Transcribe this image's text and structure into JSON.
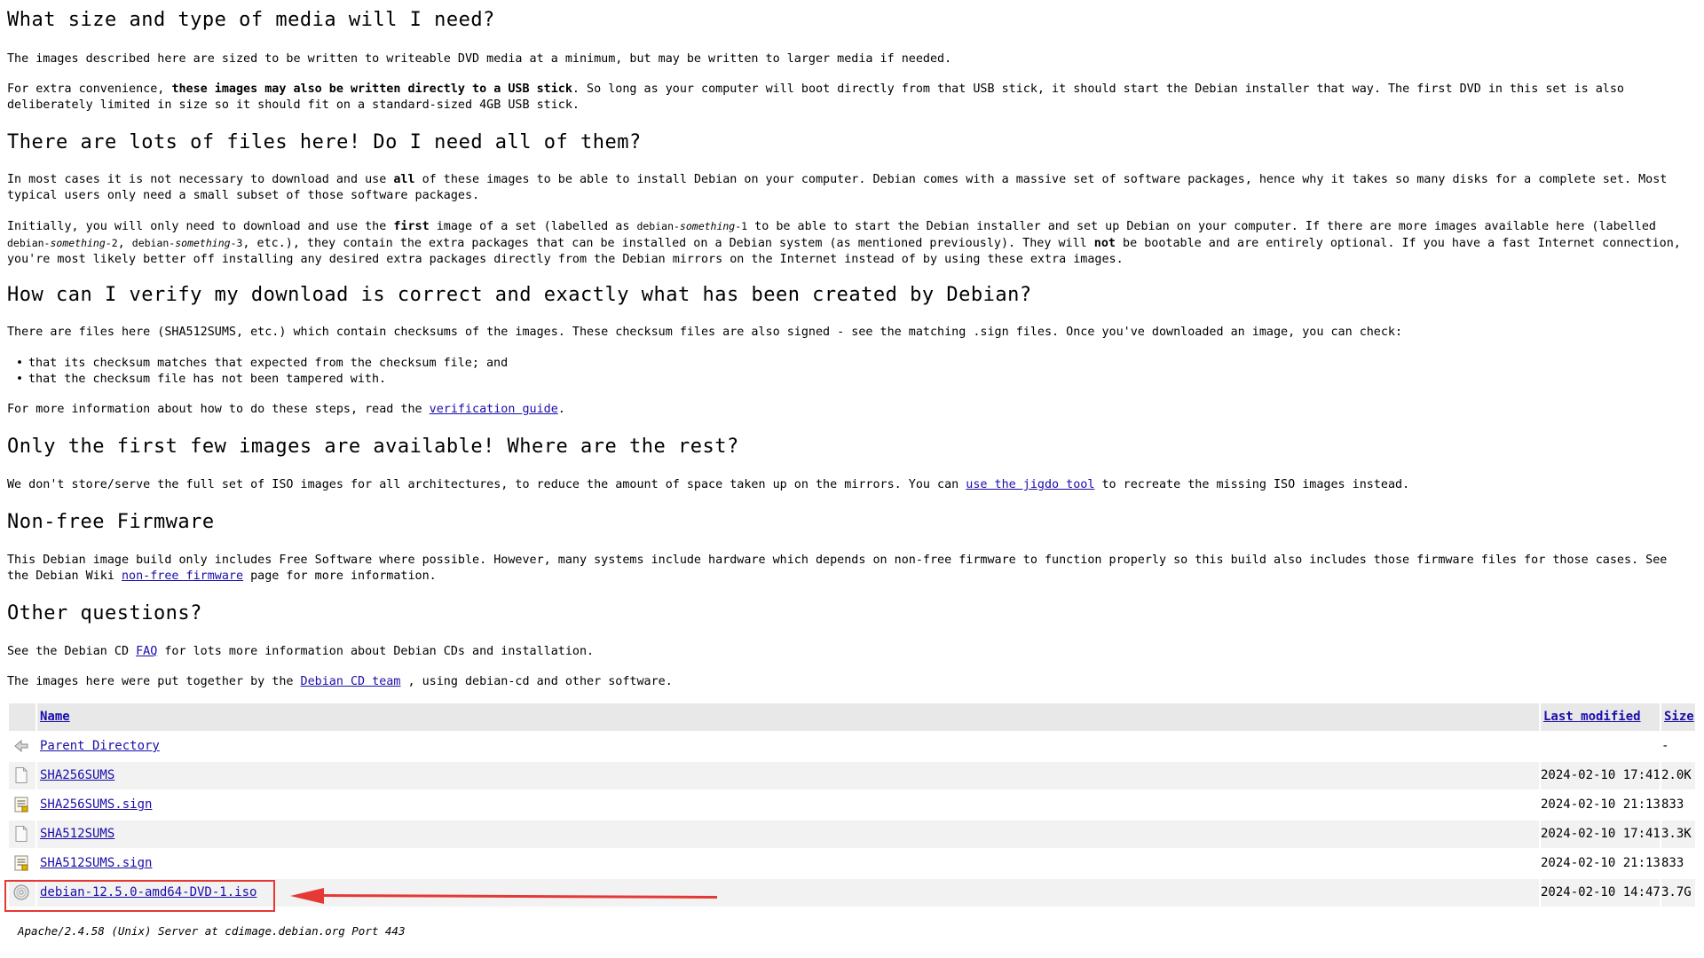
{
  "sections": {
    "media": {
      "heading": "What size and type of media will I need?",
      "p1": "The images described here are sized to be written to writeable DVD media at a minimum, but may be written to larger media if needed.",
      "p2_pre": "For extra convenience, ",
      "p2_bold": "these images may also be written directly to a USB stick",
      "p2_post": ". So long as your computer will boot directly from that USB stick, it should start the Debian installer that way. The first DVD in this set is also deliberately limited in size so it should fit on a standard-sized 4GB USB stick."
    },
    "files": {
      "heading": "There are lots of files here! Do I need all of them?",
      "p1_pre": "In most cases it is not necessary to download and use ",
      "p1_bold": "all",
      "p1_post": " of these images to be able to install Debian on your computer. Debian comes with a massive set of software packages, hence why it takes so many disks for a complete set. Most typical users only need a small subset of those software packages.",
      "p2_a": "Initially, you will only need to download and use the ",
      "p2_bold1": "first",
      "p2_b": " image of a set (labelled as ",
      "p2_ex1_pre": "debian-",
      "p2_ex1_it": "something",
      "p2_ex1_post": "-1",
      "p2_c": " to be able to start the Debian installer and set up Debian on your computer. If there are more images available here (labelled ",
      "p2_ex2_pre": "debian-",
      "p2_ex2_it": "something",
      "p2_ex2_post": "-2",
      "p2_sep": ", ",
      "p2_ex3_pre": "debian-",
      "p2_ex3_it": "something",
      "p2_ex3_post": "-3",
      "p2_d": ", etc.), they contain the extra packages that can be installed on a Debian system (as mentioned previously). They will ",
      "p2_bold2": "not",
      "p2_e": " be bootable and are entirely optional. If you have a fast Internet connection, you're most likely better off installing any desired extra packages directly from the Debian mirrors on the Internet instead of by using these extra images."
    },
    "verify": {
      "heading": "How can I verify my download is correct and exactly what has been created by Debian?",
      "p1": "There are files here (SHA512SUMS, etc.) which contain checksums of the images. These checksum files are also signed - see the matching .sign files. Once you've downloaded an image, you can check:",
      "bullets": [
        "that its checksum matches that expected from the checksum file; and",
        "that the checksum file has not been tampered with."
      ],
      "p2_pre": "For more information about how to do these steps, read the ",
      "p2_link": "verification guide",
      "p2_post": "."
    },
    "rest": {
      "heading": "Only the first few images are available! Where are the rest?",
      "p1_pre": "We don't store/serve the full set of ISO images for all architectures, to reduce the amount of space taken up on the mirrors. You can ",
      "p1_link": "use the jigdo tool",
      "p1_post": " to recreate the missing ISO images instead."
    },
    "firmware": {
      "heading": "Non-free Firmware",
      "p1_pre": "This Debian image build only includes Free Software where possible. However, many systems include hardware which depends on non-free firmware to function properly so this build also includes those firmware files for those cases. See the Debian Wiki ",
      "p1_link": "non-free firmware",
      "p1_post": " page for more information."
    },
    "other": {
      "heading": "Other questions?",
      "p1_pre": "See the Debian CD ",
      "p1_link": "FAQ",
      "p1_post": " for lots more information about Debian CDs and installation.",
      "p2_pre": "The images here were put together by the ",
      "p2_link": "Debian CD team",
      "p2_post": " , using debian-cd and other software."
    }
  },
  "listing": {
    "headers": {
      "name": "Name",
      "modified": "Last modified",
      "size": "Size"
    },
    "rows": [
      {
        "icon": "back-arrow-icon",
        "name": "Parent Directory",
        "date": "",
        "size": "-"
      },
      {
        "icon": "text-file-icon",
        "name": "SHA256SUMS",
        "date": "2024-02-10 17:41",
        "size": "2.0K"
      },
      {
        "icon": "signed-file-icon",
        "name": "SHA256SUMS.sign",
        "date": "2024-02-10 21:13",
        "size": "833"
      },
      {
        "icon": "text-file-icon",
        "name": "SHA512SUMS",
        "date": "2024-02-10 17:41",
        "size": "3.3K"
      },
      {
        "icon": "signed-file-icon",
        "name": "SHA512SUMS.sign",
        "date": "2024-02-10 21:13",
        "size": "833"
      },
      {
        "icon": "disc-image-icon",
        "name": "debian-12.5.0-amd64-DVD-1.iso",
        "date": "2024-02-10 14:47",
        "size": "3.7G"
      }
    ]
  },
  "footer": "Apache/2.4.58 (Unix) Server at cdimage.debian.org Port 443",
  "annotation_color": "#e53935",
  "link_color": "#1a0dab"
}
